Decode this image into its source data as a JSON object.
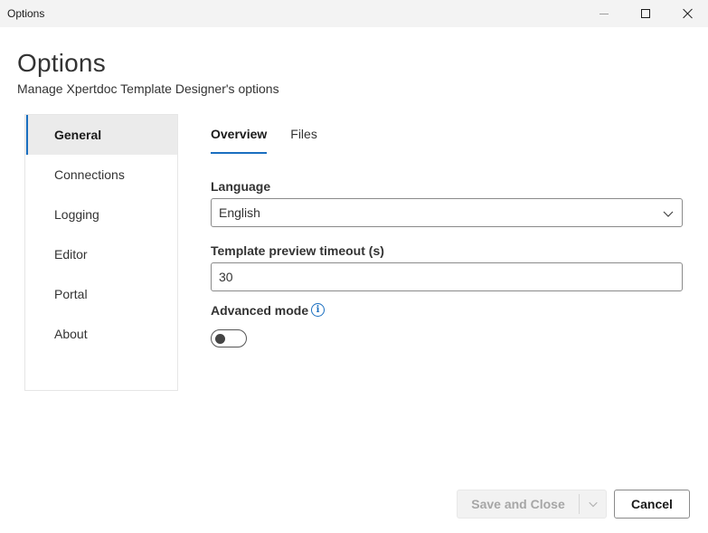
{
  "window": {
    "title": "Options"
  },
  "header": {
    "title": "Options",
    "subtitle": "Manage Xpertdoc Template Designer's options"
  },
  "sidebar": {
    "items": [
      {
        "label": "General",
        "active": true
      },
      {
        "label": "Connections",
        "active": false
      },
      {
        "label": "Logging",
        "active": false
      },
      {
        "label": "Editor",
        "active": false
      },
      {
        "label": "Portal",
        "active": false
      },
      {
        "label": "About",
        "active": false
      }
    ]
  },
  "tabs": [
    {
      "label": "Overview",
      "active": true
    },
    {
      "label": "Files",
      "active": false
    }
  ],
  "form": {
    "language_label": "Language",
    "language_value": "English",
    "timeout_label": "Template preview timeout (s)",
    "timeout_value": "30",
    "advanced_label": "Advanced mode",
    "advanced_enabled": false
  },
  "footer": {
    "save_label": "Save and Close",
    "cancel_label": "Cancel"
  },
  "colors": {
    "accent": "#1a6fc0",
    "active_nav_bg": "#ebebeb",
    "disabled_text": "#a6a6a6"
  },
  "icons": [
    "minimize-icon",
    "maximize-icon",
    "close-icon",
    "chevron-down-icon",
    "info-icon"
  ]
}
